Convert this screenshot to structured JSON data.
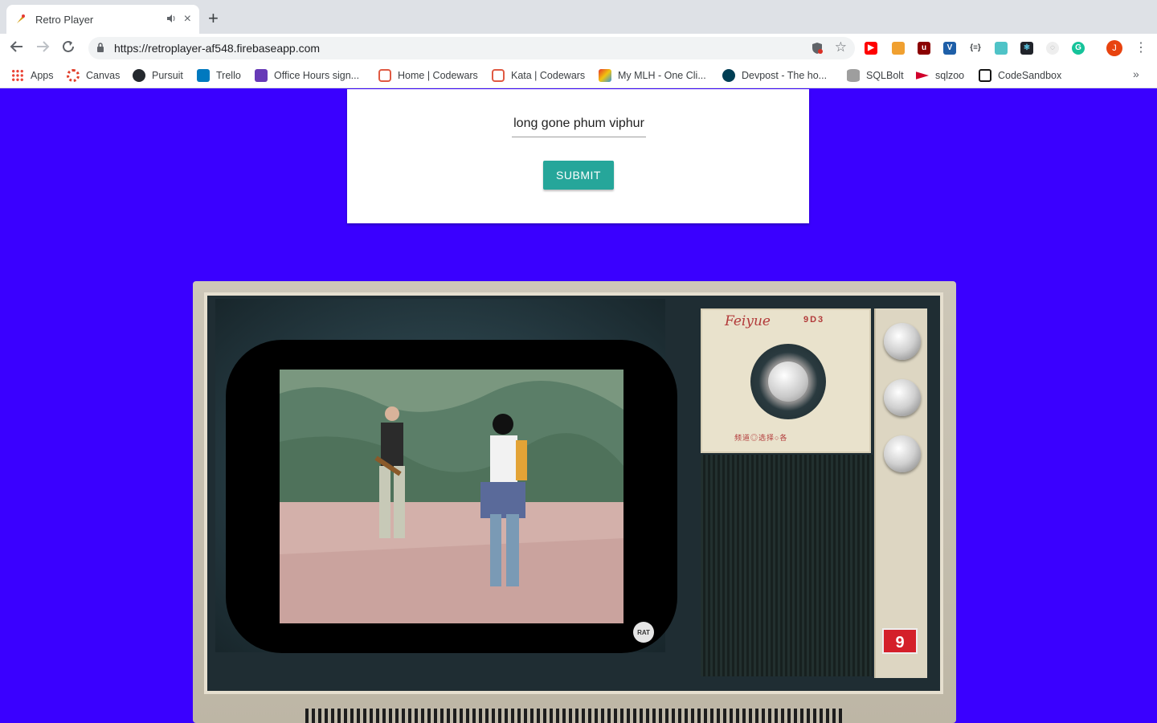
{
  "browser": {
    "tab": {
      "title": "Retro Player",
      "audio_icon": "speaker-icon",
      "close": "×"
    },
    "new_tab": "+",
    "address": {
      "url_scheme": "https://",
      "url_host": "retroplayer-af548.firebaseapp.com"
    },
    "profile_initial": "J",
    "bookmarks": [
      {
        "label": "Apps",
        "icon": "apps-grid-icon",
        "color": "#4285f4"
      },
      {
        "label": "Canvas",
        "icon": "canvas-icon",
        "color": "#e13f2b"
      },
      {
        "label": "Pursuit",
        "icon": "github-icon",
        "color": "#24292e"
      },
      {
        "label": "Trello",
        "icon": "trello-icon",
        "color": "#0079bf"
      },
      {
        "label": "Office Hours sign...",
        "icon": "forms-icon",
        "color": "#673ab7"
      },
      {
        "label": "Home | Codewars",
        "icon": "codewars-icon",
        "color": "#e05a43"
      },
      {
        "label": "Kata | Codewars",
        "icon": "codewars-icon",
        "color": "#e05a43"
      },
      {
        "label": "My MLH - One Cli...",
        "icon": "mlh-icon",
        "color": "#e73427"
      },
      {
        "label": "Devpost - The ho...",
        "icon": "devpost-icon",
        "color": "#003e54"
      },
      {
        "label": "SQLBolt",
        "icon": "database-icon",
        "color": "#7d7d7d"
      },
      {
        "label": "sqlzoo",
        "icon": "sqlzoo-icon",
        "color": "#d1002c"
      },
      {
        "label": "CodeSandbox",
        "icon": "codesandbox-icon",
        "color": "#151515"
      }
    ],
    "bookmarks_overflow": "»"
  },
  "page": {
    "song_input_value": "long gone phum viphur",
    "submit_label": "SUBMIT",
    "accent_color": "#26a69a",
    "background_color": "#3a00ff"
  },
  "tv": {
    "brand": "Feiyue",
    "model": "9D3",
    "dial_caption": "频道◎选择○各",
    "channel_badge": "9",
    "video_badge": "RAT"
  }
}
